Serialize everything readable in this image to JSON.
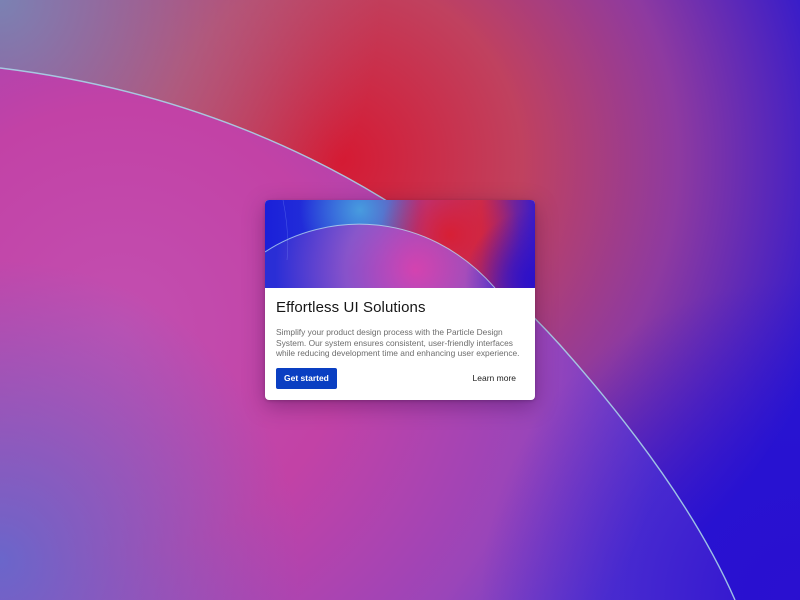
{
  "card": {
    "title": "Effortless UI Solutions",
    "description": "Simplify your product design process with the Particle Design System. Our system ensures consistent, user-friendly interfaces while reducing development time and enhancing user experience.",
    "primary_action_label": "Get started",
    "secondary_action_label": "Learn more"
  },
  "colors": {
    "primary_button": "#0a3fc2",
    "title_text": "#161616",
    "body_text": "#6d6d6d",
    "card_background": "#ffffff"
  }
}
